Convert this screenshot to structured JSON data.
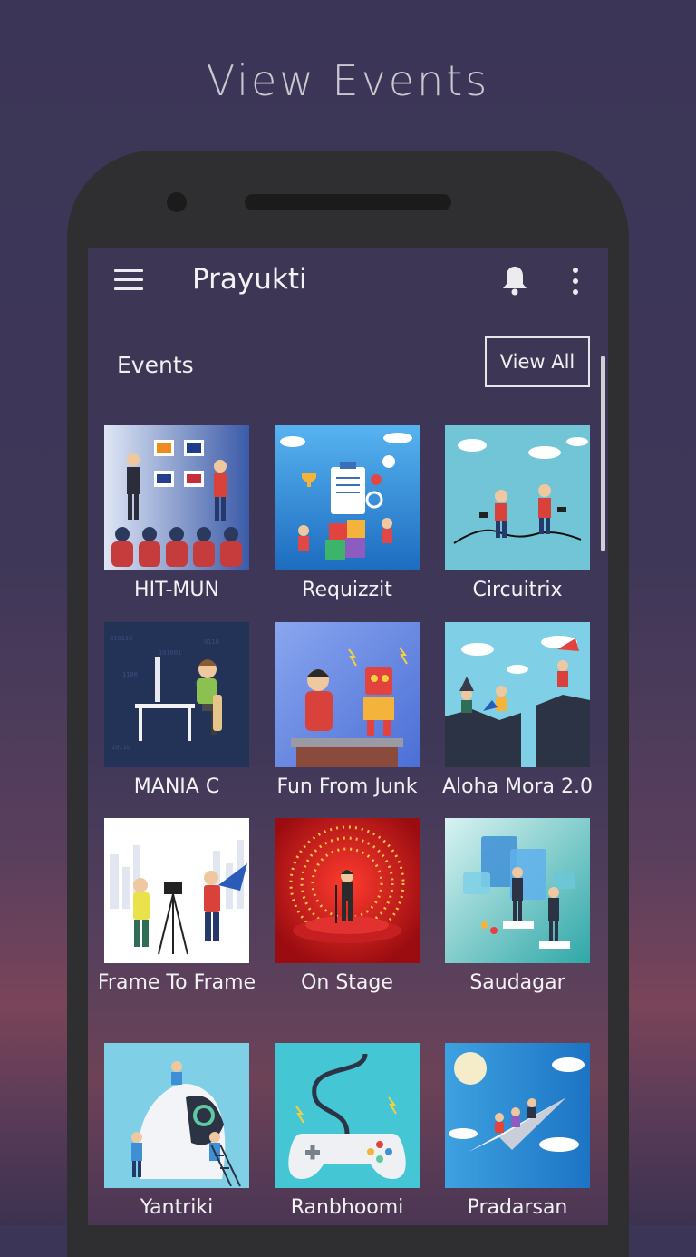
{
  "headline": "View Events",
  "appbar": {
    "title": "Prayukti",
    "menu_icon": "menu-icon",
    "notification_icon": "bell-icon",
    "overflow_icon": "more-vert-icon"
  },
  "section": {
    "title": "Events",
    "view_all_label": "View All"
  },
  "events": [
    {
      "label": "HIT-MUN"
    },
    {
      "label": "Requizzit"
    },
    {
      "label": "Circuitrix"
    },
    {
      "label": "MANIA C"
    },
    {
      "label": "Fun From Junk"
    },
    {
      "label": "Aloha Mora 2.0"
    },
    {
      "label": "Frame To Frame"
    },
    {
      "label": "On Stage"
    },
    {
      "label": "Saudagar"
    },
    {
      "label": "Yantriki"
    },
    {
      "label": "Ranbhoomi"
    },
    {
      "label": "Pradarsan"
    }
  ],
  "colors": {
    "background": "#3e3758",
    "phone_frame": "#2f2f31",
    "text": "#f2f2f5"
  }
}
